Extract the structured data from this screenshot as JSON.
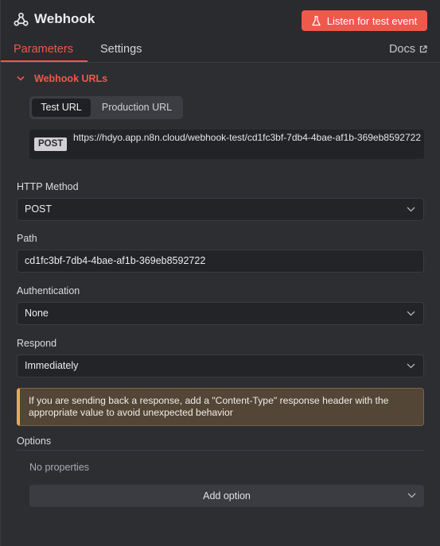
{
  "header": {
    "title": "Webhook",
    "node_icon": "webhook-icon",
    "listen_button": "Listen for test event",
    "listen_icon": "flask-icon",
    "accent": "#f0584c"
  },
  "tabs": [
    {
      "label": "Parameters",
      "active": true
    },
    {
      "label": "Settings",
      "active": false
    }
  ],
  "docs": {
    "label": "Docs",
    "icon": "external-link-icon"
  },
  "webhook_urls": {
    "title": "Webhook URLs",
    "toggle_icon": "chevron-down-icon",
    "options": [
      "Test URL",
      "Production URL"
    ],
    "selected": "Test URL",
    "method_badge": "POST",
    "url": "https://hdyo.app.n8n.cloud/webhook-test/cd1fc3bf-7db4-4bae-af1b-369eb8592722"
  },
  "fields": {
    "http_method": {
      "label": "HTTP Method",
      "value": "POST"
    },
    "path": {
      "label": "Path",
      "value": "cd1fc3bf-7db4-4bae-af1b-369eb8592722"
    },
    "authentication": {
      "label": "Authentication",
      "value": "None"
    },
    "respond": {
      "label": "Respond",
      "value": "Immediately"
    }
  },
  "notice": {
    "text": "If you are sending back a response, add a \"Content-Type\" response header with the appropriate value to avoid unexpected behavior",
    "color": "#e8a94e"
  },
  "options": {
    "label": "Options",
    "empty_text": "No properties",
    "add_button": "Add option"
  }
}
